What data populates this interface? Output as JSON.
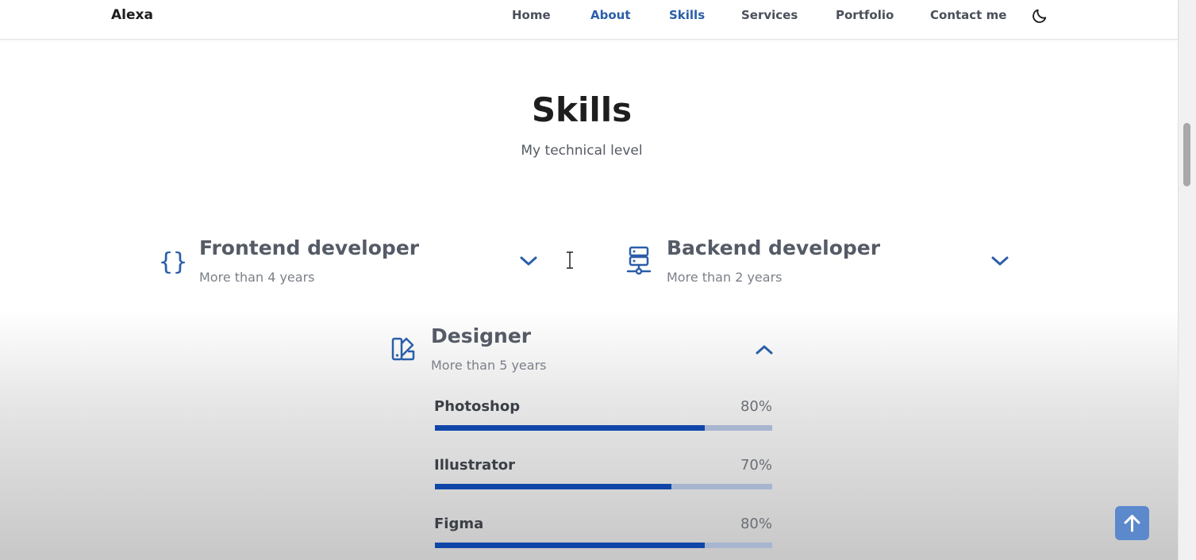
{
  "header": {
    "logo": "Alexa",
    "nav": [
      "Home",
      "About",
      "Skills",
      "Services",
      "Portfolio",
      "Contact me"
    ],
    "theme_toggle_icon": "moon-icon"
  },
  "section": {
    "title": "Skills",
    "subtitle": "My technical level"
  },
  "skills": [
    {
      "title": "Frontend developer",
      "years": "More than 4 years",
      "icon": "braces-icon",
      "expanded": false
    },
    {
      "title": "Backend developer",
      "years": "More than 2 years",
      "icon": "server-icon",
      "expanded": false
    },
    {
      "title": "Designer",
      "years": "More than 5 years",
      "icon": "palette-swatch-icon",
      "expanded": true,
      "items": [
        {
          "name": "Photoshop",
          "percent": "80%",
          "level": 80
        },
        {
          "name": "Illustrator",
          "percent": "70%",
          "level": 70
        },
        {
          "name": "Figma",
          "percent": "80%",
          "level": 80
        }
      ]
    }
  ],
  "colors": {
    "accent": "#2b5ea8",
    "bar_fill": "#0f46a8",
    "bar_track": "#a7b5cf",
    "scroll_top_bg": "#5c89cc"
  },
  "scroll_top_icon": "arrow-up-icon"
}
